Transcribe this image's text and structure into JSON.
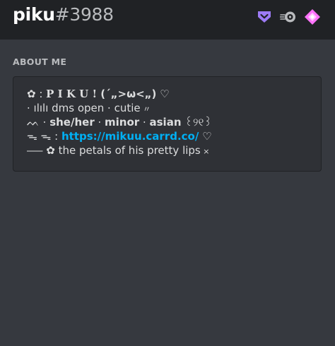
{
  "profile": {
    "name": "piku",
    "tag": "#3988",
    "badges": [
      {
        "icon": "hypesquad-balance-icon",
        "color": "#9d7bf5"
      },
      {
        "icon": "nitro-icon",
        "color": "#b9bbbe"
      },
      {
        "icon": "server-boost-icon",
        "color": "#ff73fa"
      }
    ]
  },
  "about": {
    "title": "ABOUT ME",
    "line1": {
      "flower": "✿",
      "sep": " : ",
      "name": "P I K U ! ",
      "emoticon": "(´„>ω<„)",
      "heart": " ♡"
    },
    "line2": {
      "text": " ⋅ ılılı dms open ⋅ cutie",
      "mark": " 〃"
    },
    "line3": {
      "wave": "ᨓ",
      "dot1": " ⋅ ",
      "pronouns": "she/her",
      "dot2": " ⋅ ",
      "age": "minor",
      "dot3": " ⋅ ",
      "ethnicity": "asian",
      "deco": " ꒰୨୧꒱"
    },
    "line4": {
      "bow": "ᯓ ᯓ",
      "sep": " : ",
      "link": "https://mikuu.carrd.co/",
      "heart": " ♡"
    },
    "line5": {
      "dash": "⎯⎯⎯",
      "flower": " ✿",
      "text": " the petals of his pretty lips",
      "x": " ×"
    }
  }
}
